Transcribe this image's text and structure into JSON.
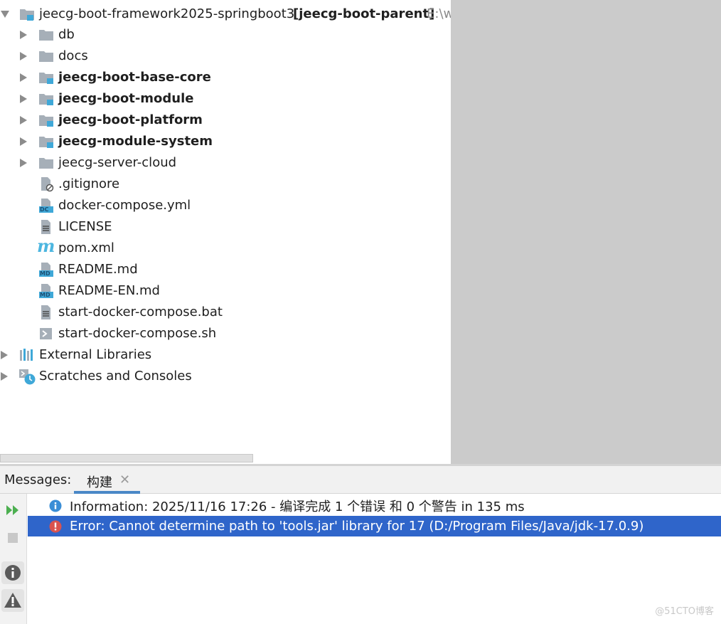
{
  "project_tree": {
    "root": {
      "name": "jeecg-boot-framework2025-springboot3",
      "module": "[jeecg-boot-parent]",
      "path": "E:\\w"
    },
    "items": [
      {
        "label": "db",
        "type": "folder",
        "bold": false
      },
      {
        "label": "docs",
        "type": "folder",
        "bold": false
      },
      {
        "label": "jeecg-boot-base-core",
        "type": "module",
        "bold": true
      },
      {
        "label": "jeecg-boot-module",
        "type": "module",
        "bold": true
      },
      {
        "label": "jeecg-boot-platform",
        "type": "module",
        "bold": true
      },
      {
        "label": "jeecg-module-system",
        "type": "module",
        "bold": true
      },
      {
        "label": "jeecg-server-cloud",
        "type": "folder",
        "bold": false
      },
      {
        "label": ".gitignore",
        "type": "gitignore-file",
        "bold": false
      },
      {
        "label": "docker-compose.yml",
        "type": "docker-compose-file",
        "icon_text": "DC",
        "bold": false
      },
      {
        "label": "LICENSE",
        "type": "text-file",
        "bold": false
      },
      {
        "label": "pom.xml",
        "type": "maven-file",
        "icon_text": "m",
        "bold": false
      },
      {
        "label": "README.md",
        "type": "markdown-file",
        "icon_text": "MD",
        "bold": false
      },
      {
        "label": "README-EN.md",
        "type": "markdown-file",
        "icon_text": "MD",
        "bold": false
      },
      {
        "label": "start-docker-compose.bat",
        "type": "text-file",
        "bold": false
      },
      {
        "label": "start-docker-compose.sh",
        "type": "shell-file",
        "bold": false
      }
    ],
    "external_libraries": "External Libraries",
    "scratches": "Scratches and Consoles"
  },
  "messages": {
    "title": "Messages:",
    "tab_label": "构建",
    "close_glyph": "✕",
    "rows": [
      {
        "level": "info",
        "text": "Information: 2025/11/16 17:26 - 编译完成 1 个错误 和 0 个警告 in 135 ms"
      },
      {
        "level": "error",
        "text": "Error: Cannot determine path to 'tools.jar' library for 17 (D:/Program Files/Java/jdk-17.0.9)"
      }
    ]
  },
  "watermark": "@51CTO博客",
  "colors": {
    "selection": "#2f65ca",
    "module_badge": "#3fa8d8",
    "folder": "#a6afb8",
    "info": "#3b8ed6",
    "error": "#d9534f",
    "run_green": "#4caf50"
  }
}
